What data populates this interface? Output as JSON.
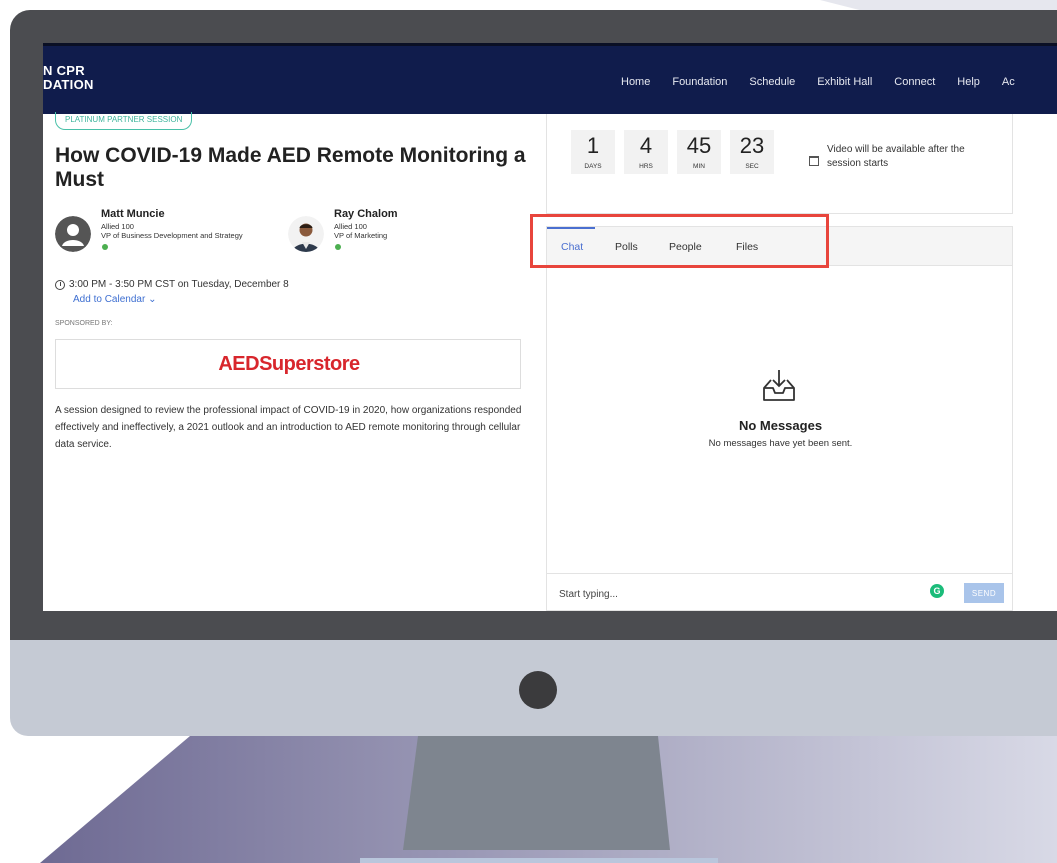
{
  "site": {
    "logo_line1": "N CPR",
    "logo_line2": "DATION"
  },
  "nav": [
    "Home",
    "Foundation",
    "Schedule",
    "Exhibit Hall",
    "Connect",
    "Help",
    "Ac"
  ],
  "session": {
    "badge": "PLATINUM PARTNER SESSION",
    "title": "How COVID-19 Made AED Remote Monitoring a Must",
    "time": "3:00 PM - 3:50 PM CST on Tuesday, December 8",
    "add_to_calendar": "Add to Calendar",
    "sponsored_by": "SPONSORED BY:",
    "sponsor_logo_part1": "AED",
    "sponsor_logo_part2": "Superstore",
    "description": "A session designed to review the professional impact of COVID-19 in 2020, how organizations responded effectively and ineffectively, a 2021 outlook and an introduction to AED remote monitoring through cellular data service."
  },
  "speakers": [
    {
      "name": "Matt Muncie",
      "org": "Allied 100",
      "role": "VP of Business Development and Strategy"
    },
    {
      "name": "Ray Chalom",
      "org": "Allied 100",
      "role": "VP of Marketing"
    }
  ],
  "countdown": [
    {
      "value": "1",
      "label": "DAYS"
    },
    {
      "value": "4",
      "label": "HRS"
    },
    {
      "value": "45",
      "label": "MIN"
    },
    {
      "value": "23",
      "label": "SEC"
    }
  ],
  "video_note": "Video will be available after the session starts",
  "tabs": [
    "Chat",
    "Polls",
    "People",
    "Files"
  ],
  "chat": {
    "empty_title": "No Messages",
    "empty_sub": "No messages have yet been sent.",
    "placeholder": "Start typing...",
    "send_label": "SEND",
    "grammarly": "G"
  },
  "colors": {
    "nav_bg": "#101c4c",
    "accent": "#4a6fd0",
    "highlight": "#e8453c",
    "sponsor": "#d8262c"
  }
}
